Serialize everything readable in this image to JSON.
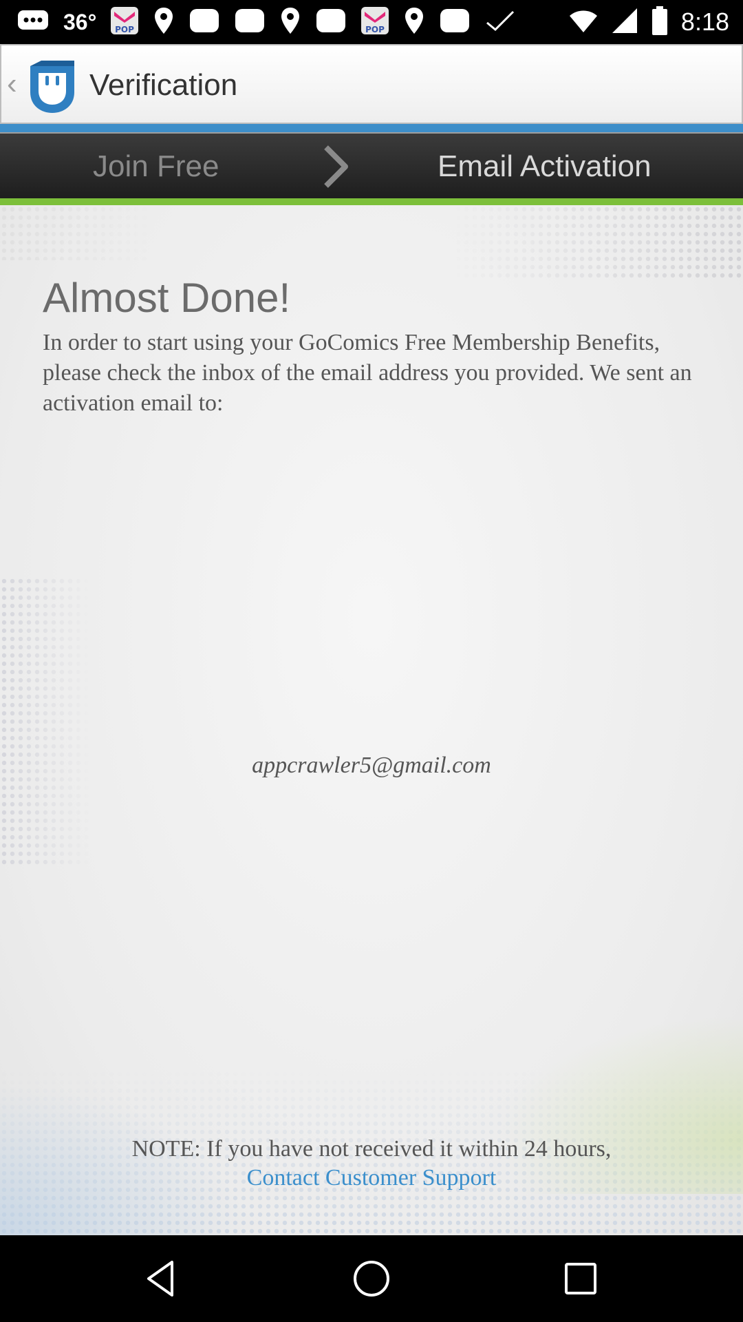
{
  "status_bar": {
    "signal_text": "36°",
    "time": "8:18",
    "icons": [
      "message-icon",
      "pop-app-icon",
      "location-icon",
      "notification-icon",
      "notification-icon",
      "location-icon",
      "notification-icon",
      "pop-app-icon",
      "location-icon",
      "notification-icon",
      "check-icon",
      "wifi-icon",
      "cellular-signal-icon",
      "battery-icon"
    ]
  },
  "action_bar": {
    "title": "Verification",
    "back_glyph": "‹",
    "logo_color": "#2f7fc1"
  },
  "steps": {
    "step1": "Join Free",
    "step2": "Email Activation"
  },
  "content": {
    "headline": "Almost Done!",
    "intro": "In order to start using your GoComics Free Membership Benefits, please check the inbox of the email address you provided. We sent an activation email to:",
    "email": "appcrawler5@gmail.com",
    "note": "NOTE: If you have not received it within 24 hours,",
    "support_link": "Contact Customer Support"
  },
  "colors": {
    "accent_blue": "#3d8ec9",
    "accent_green": "#7cbf3a",
    "link": "#3b8fcc"
  },
  "nav_bar": {
    "buttons": [
      "back-icon",
      "home-icon",
      "recents-icon"
    ]
  }
}
